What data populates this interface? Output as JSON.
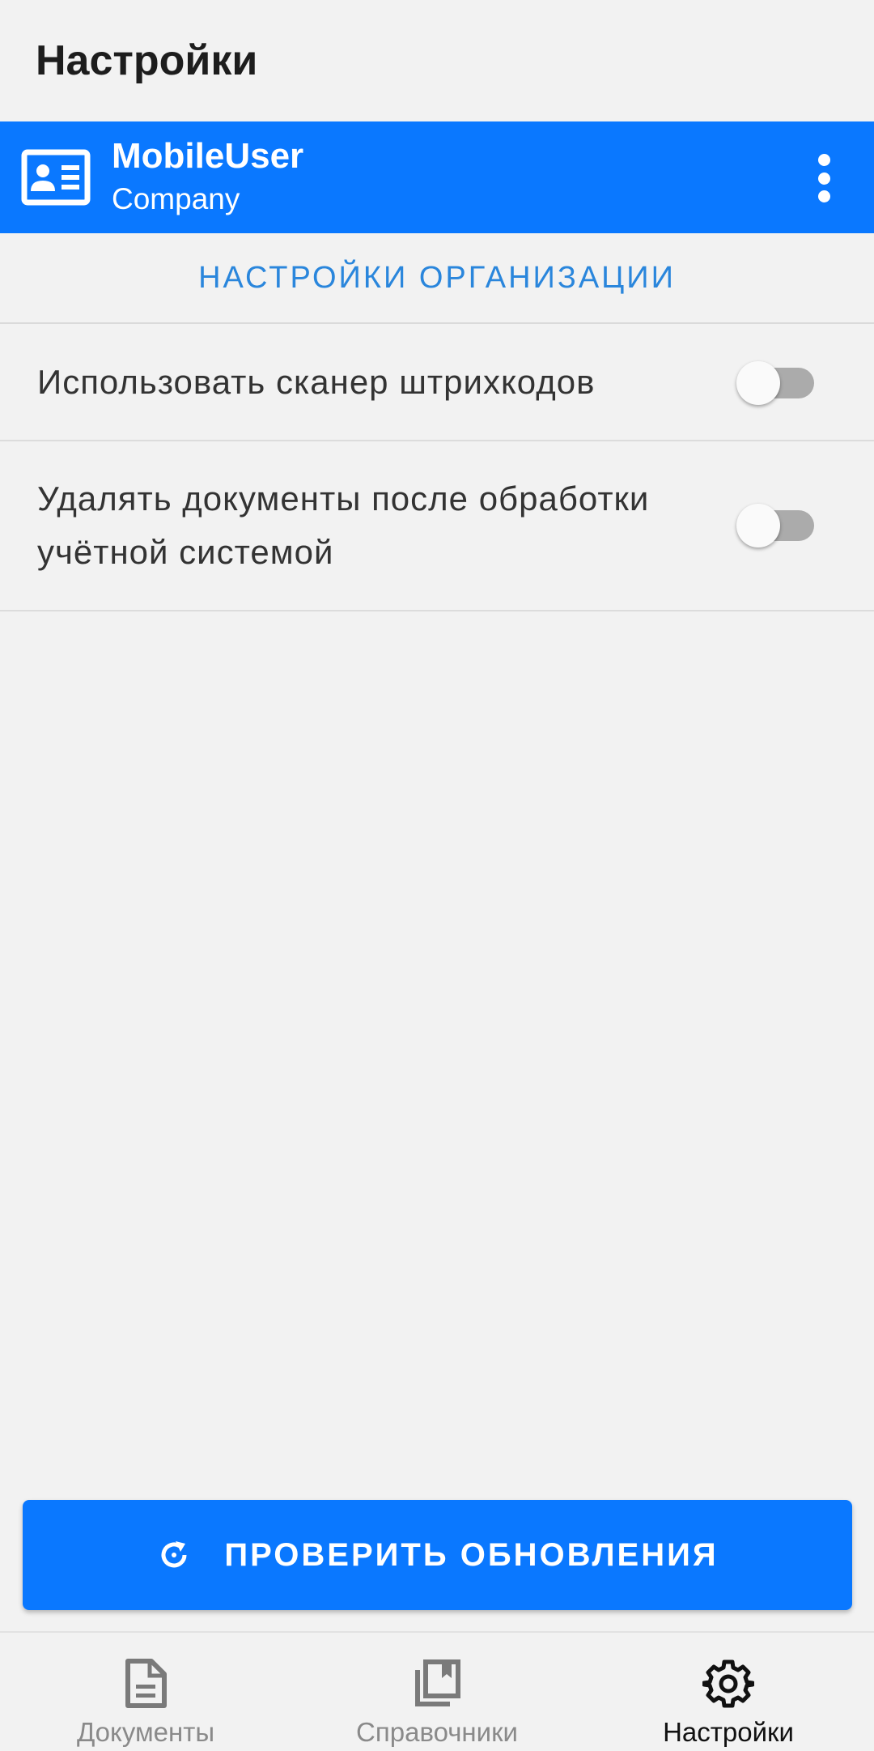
{
  "header": {
    "title": "Настройки"
  },
  "account": {
    "icon": "id-card-icon",
    "user": "MobileUser",
    "company": "Company",
    "menu_icon": "more-vert-icon"
  },
  "org_settings_link": "НАСТРОЙКИ ОРГАНИЗАЦИИ",
  "settings": [
    {
      "label": "Использовать сканер штрихкодов",
      "enabled": false
    },
    {
      "label": "Удалять документы после обработки учётной системой",
      "enabled": false
    }
  ],
  "update_button": {
    "label": "ПРОВЕРИТЬ ОБНОВЛЕНИЯ",
    "icon": "refresh-icon"
  },
  "bottom_nav": [
    {
      "label": "Документы",
      "icon": "document-icon",
      "active": false
    },
    {
      "label": "Справочники",
      "icon": "library-books-icon",
      "active": false
    },
    {
      "label": "Настройки",
      "icon": "gear-icon",
      "active": true
    }
  ],
  "colors": {
    "accent": "#0a78ff",
    "link": "#2a86dc",
    "background": "#f2f2f2"
  }
}
